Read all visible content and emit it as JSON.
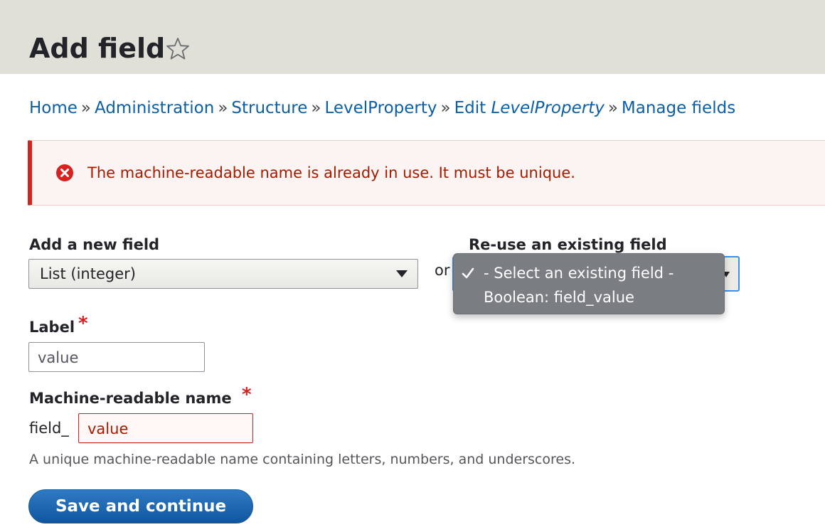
{
  "header": {
    "title": "Add field",
    "shortcut_icon": "star-outline-icon"
  },
  "breadcrumb": {
    "items": [
      "Home",
      "Administration",
      "Structure",
      "LevelProperty"
    ],
    "edit_prefix": "Edit ",
    "edit_entity": "LevelProperty",
    "last": "Manage fields",
    "separator": "»"
  },
  "error": {
    "icon": "error-circle-icon",
    "message": "The machine-readable name is already in use. It must be unique.",
    "color": "#d72222"
  },
  "add_new_field": {
    "label": "Add a new field",
    "selected": "List (integer)"
  },
  "or_label": "or",
  "reuse_field": {
    "label": "Re-use an existing field",
    "options": [
      "- Select an existing field -",
      "Boolean: field_value"
    ],
    "selected_index": 0
  },
  "label_field": {
    "label": "Label",
    "required": "*",
    "value": "value"
  },
  "machine_name": {
    "label": "Machine-readable name",
    "required": "*",
    "prefix": "field_",
    "value": "value",
    "description": "A unique machine-readable name containing letters, numbers, and underscores."
  },
  "actions": {
    "save_label": "Save and continue",
    "primary_color": "#0f56a0"
  }
}
